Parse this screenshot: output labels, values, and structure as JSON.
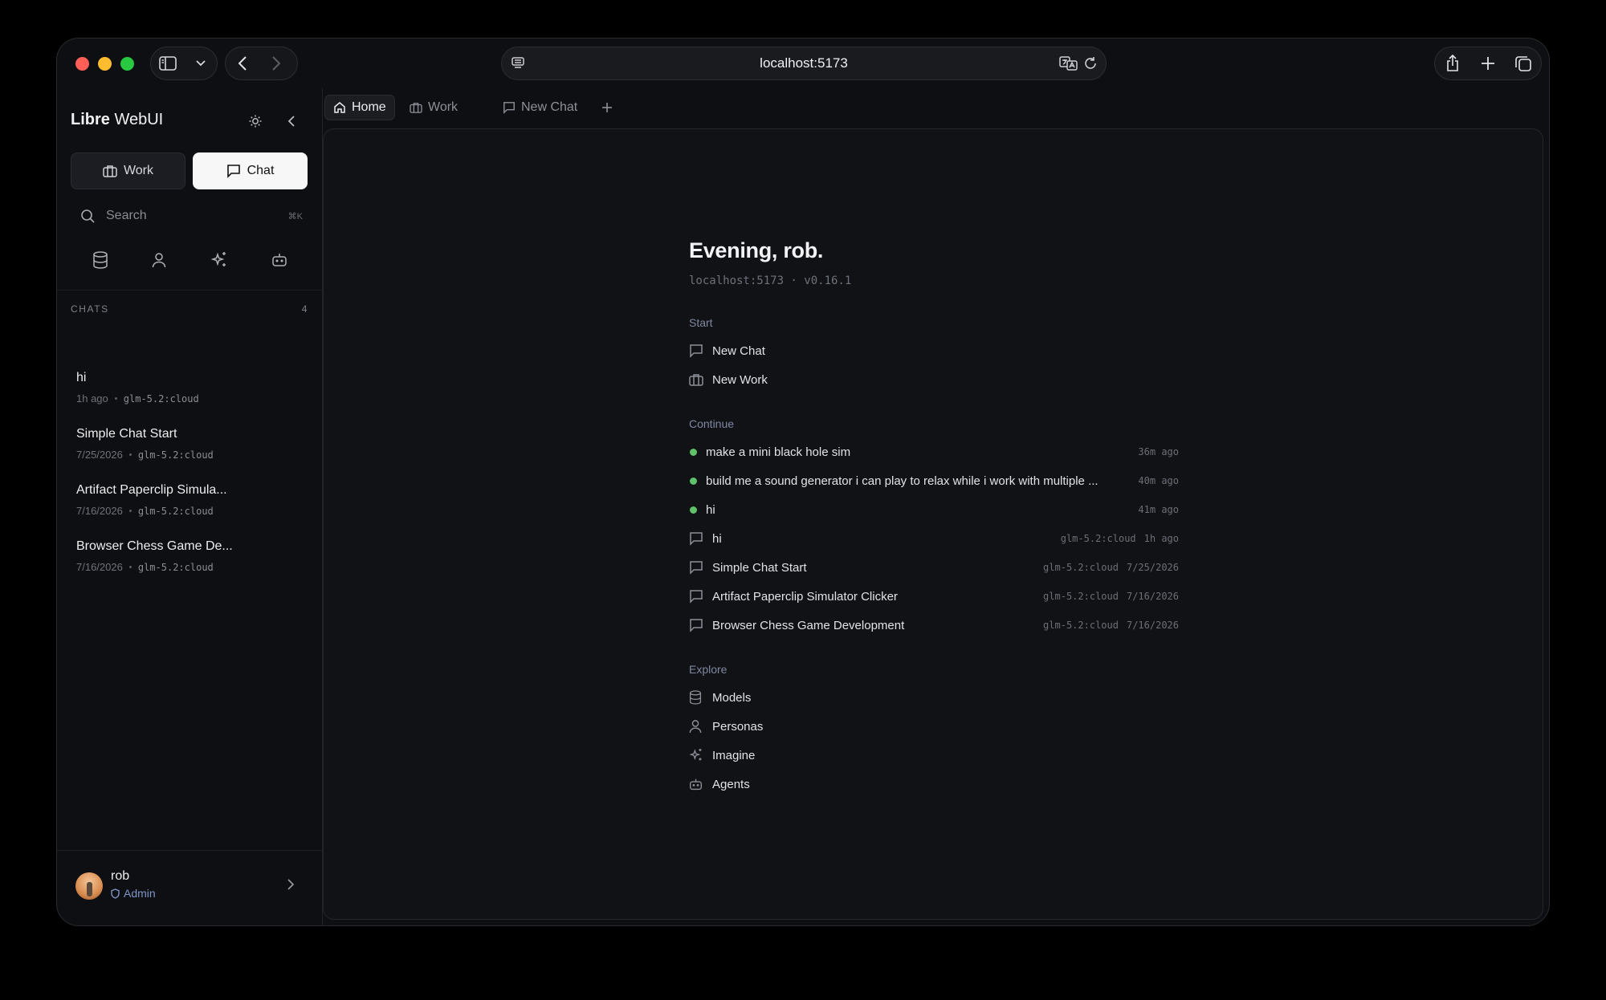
{
  "browser": {
    "url": "localhost:5173"
  },
  "sidebar": {
    "brand_bold": "Libre",
    "brand_rest": " WebUI",
    "mode_work": "Work",
    "mode_chat": "Chat",
    "search_label": "Search",
    "search_shortcut": "⌘K",
    "chats_header": "CHATS",
    "chats_count": "4",
    "chats": [
      {
        "title": "hi",
        "time": "1h ago",
        "model": "glm-5.2:cloud"
      },
      {
        "title": "Simple Chat Start",
        "time": "7/25/2026",
        "model": "glm-5.2:cloud"
      },
      {
        "title": "Artifact Paperclip Simula...",
        "time": "7/16/2026",
        "model": "glm-5.2:cloud"
      },
      {
        "title": "Browser Chess Game De...",
        "time": "7/16/2026",
        "model": "glm-5.2:cloud"
      }
    ],
    "user": {
      "name": "rob",
      "role": "Admin"
    }
  },
  "tabs": [
    {
      "label": "Home",
      "active": true
    },
    {
      "label": "Work"
    },
    {
      "label": "New Chat"
    }
  ],
  "home": {
    "greeting": "Evening, rob.",
    "host_line": "localhost:5173 · v0.16.1",
    "start_label": "Start",
    "start_items": [
      "New Chat",
      "New Work"
    ],
    "continue_label": "Continue",
    "running": [
      {
        "title": "make a mini black hole sim",
        "time": "36m ago"
      },
      {
        "title": "build me a sound generator i can play to relax while i work with multiple ...",
        "time": "40m ago"
      },
      {
        "title": "hi",
        "time": "41m ago"
      }
    ],
    "recent": [
      {
        "title": "hi",
        "model": "glm-5.2:cloud",
        "time": "1h ago"
      },
      {
        "title": "Simple Chat Start",
        "model": "glm-5.2:cloud",
        "time": "7/25/2026"
      },
      {
        "title": "Artifact Paperclip Simulator Clicker",
        "model": "glm-5.2:cloud",
        "time": "7/16/2026"
      },
      {
        "title": "Browser Chess Game Development",
        "model": "glm-5.2:cloud",
        "time": "7/16/2026"
      }
    ],
    "explore_label": "Explore",
    "explore_items": [
      "Models",
      "Personas",
      "Imagine",
      "Agents"
    ]
  },
  "colors": {
    "accent_green": "#5fc16a",
    "admin_blue": "#7e96c8"
  }
}
